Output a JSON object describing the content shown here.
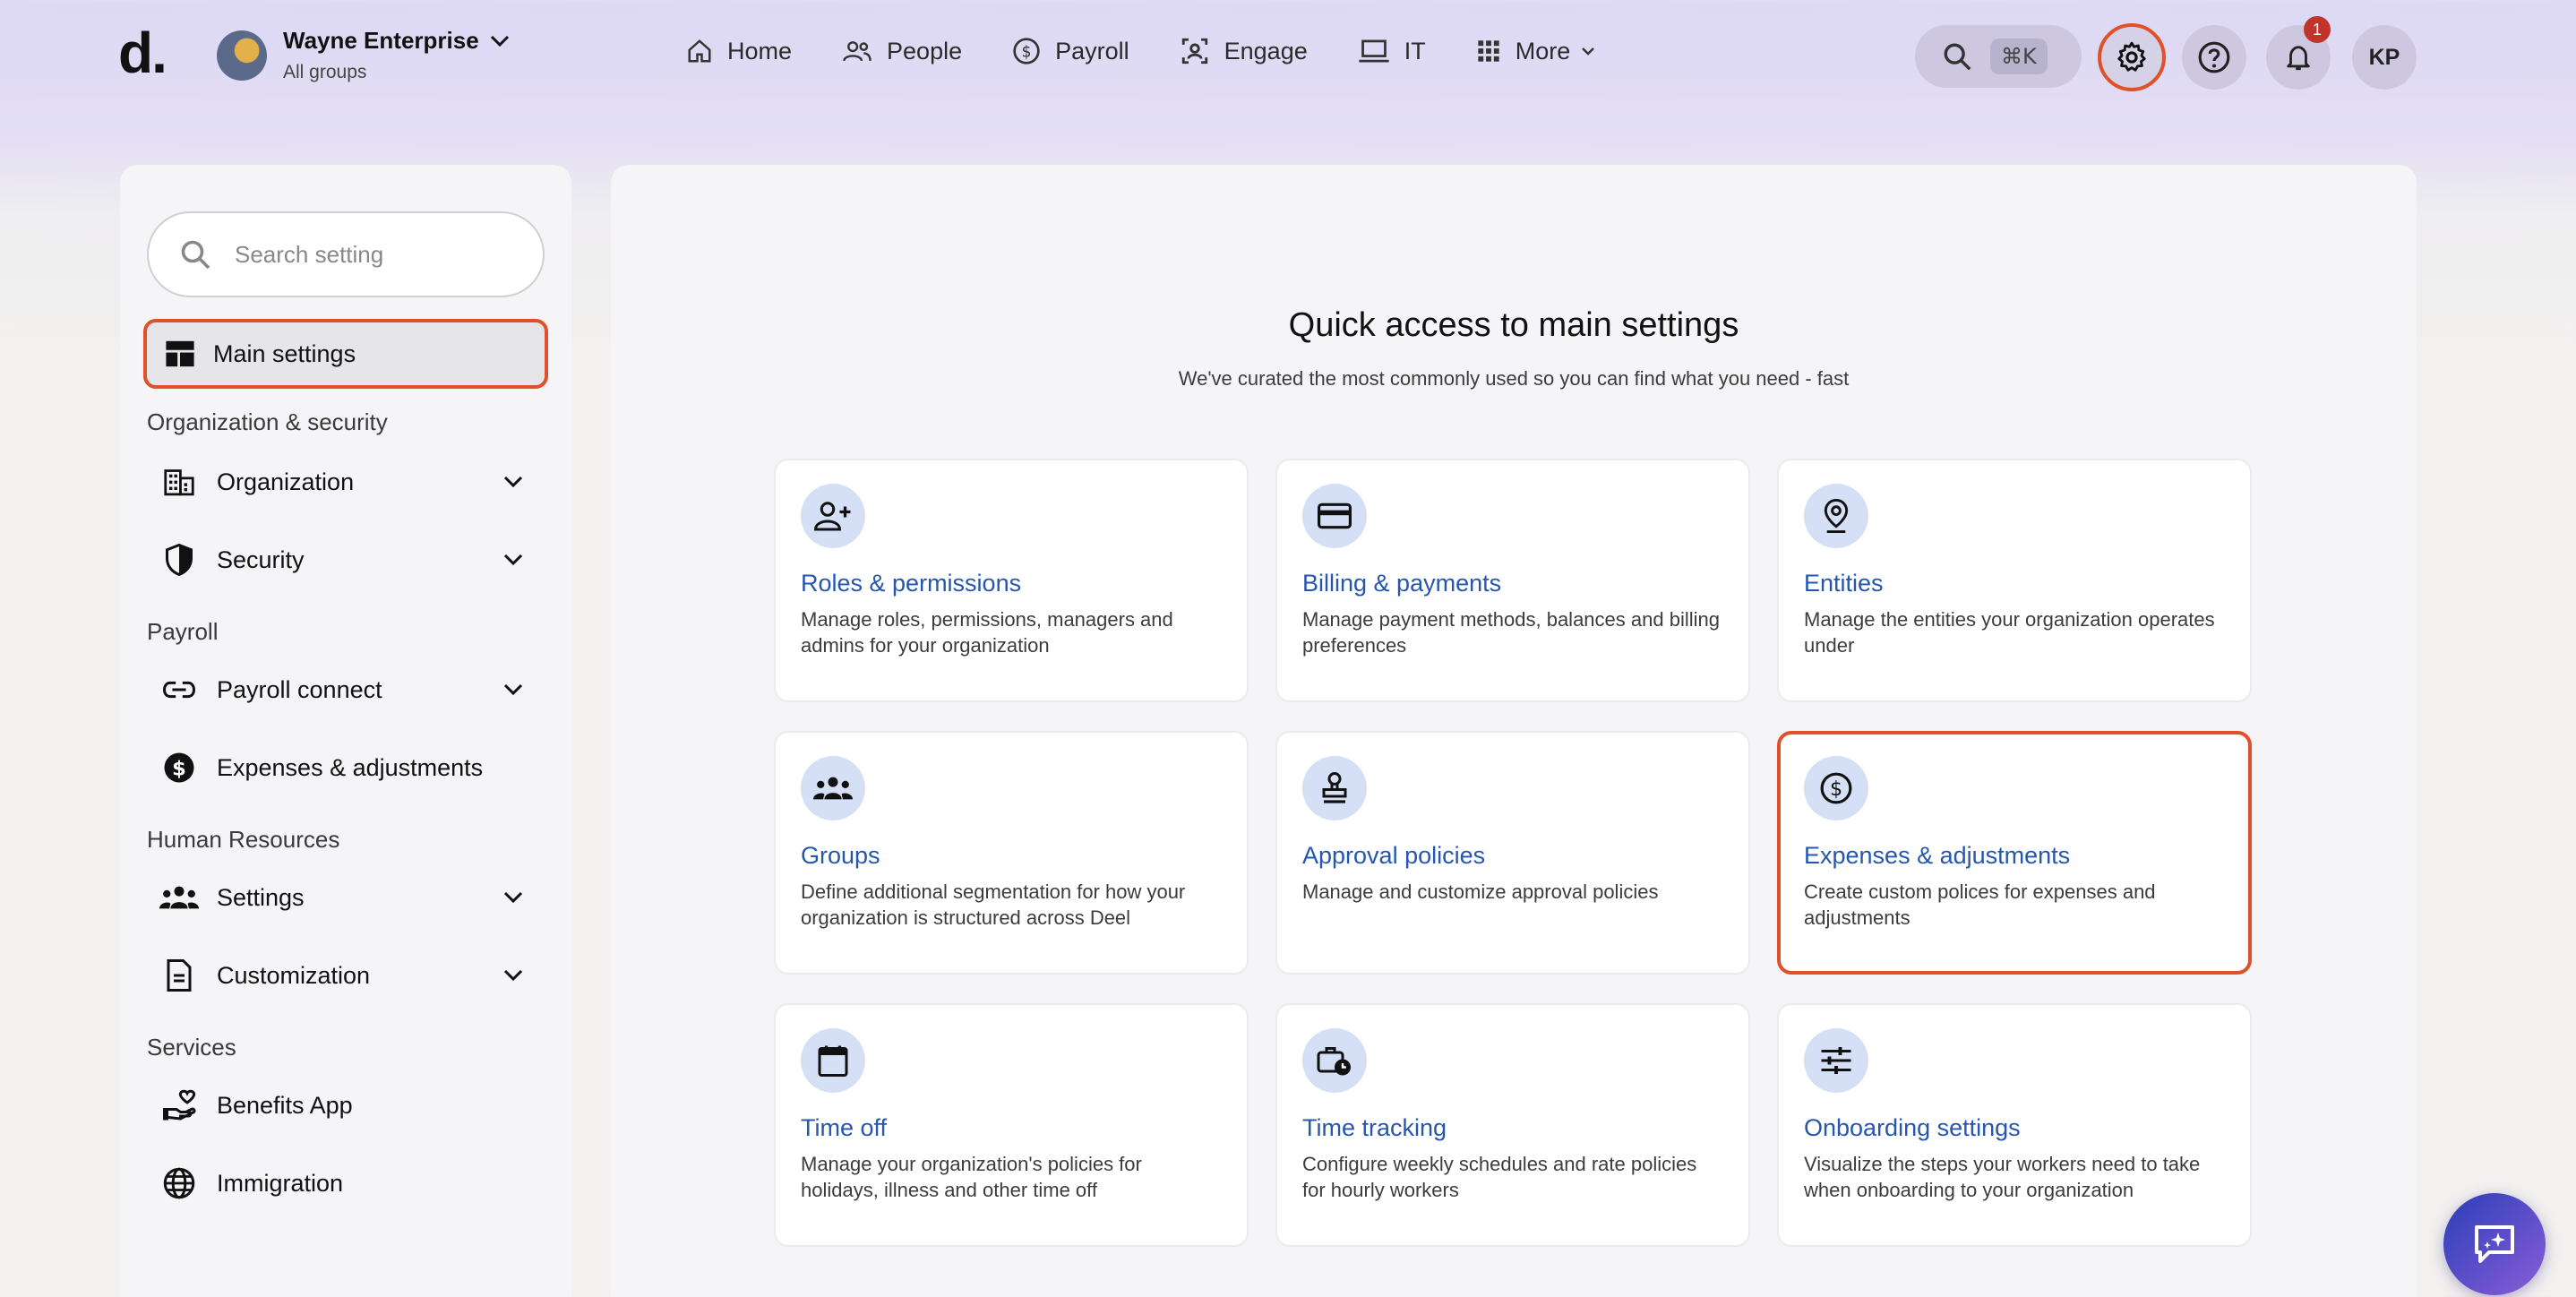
{
  "header": {
    "logo": "d.",
    "org_name": "Wayne Enterprise",
    "org_sub": "All groups",
    "nav": [
      {
        "label": "Home",
        "icon": "home-icon"
      },
      {
        "label": "People",
        "icon": "people-icon"
      },
      {
        "label": "Payroll",
        "icon": "dollar-circle-icon"
      },
      {
        "label": "Engage",
        "icon": "engage-icon"
      },
      {
        "label": "IT",
        "icon": "laptop-icon"
      },
      {
        "label": "More",
        "icon": "grid-icon"
      }
    ],
    "search_shortcut": "⌘K",
    "notification_count": "1",
    "user_initials": "KP"
  },
  "sidebar": {
    "search_placeholder": "Search setting",
    "main_settings": "Main settings",
    "sections": {
      "org_security": "Organization & security",
      "payroll": "Payroll",
      "hr": "Human Resources",
      "services": "Services"
    },
    "items": {
      "organization": "Organization",
      "security": "Security",
      "payroll_connect": "Payroll connect",
      "expenses": "Expenses & adjustments",
      "settings": "Settings",
      "customization": "Customization",
      "benefits": "Benefits App",
      "immigration": "Immigration"
    }
  },
  "main": {
    "title": "Quick access to main settings",
    "subtitle": "We've curated the most commonly used so you can find what you need - fast",
    "cards": [
      {
        "title": "Roles & permissions",
        "desc": "Manage roles, permissions, managers and admins for your organization",
        "icon": "user-plus-icon"
      },
      {
        "title": "Billing & payments",
        "desc": "Manage payment methods, balances and billing preferences",
        "icon": "credit-card-icon"
      },
      {
        "title": "Entities",
        "desc": "Manage the entities your organization operates under",
        "icon": "location-pin-icon"
      },
      {
        "title": "Groups",
        "desc": "Define additional segmentation for how your organization is structured across Deel",
        "icon": "groups-icon"
      },
      {
        "title": "Approval policies",
        "desc": "Manage and customize approval policies",
        "icon": "stamp-icon"
      },
      {
        "title": "Expenses & adjustments",
        "desc": "Create custom polices for expenses and adjustments",
        "icon": "dollar-circle-icon"
      },
      {
        "title": "Time off",
        "desc": "Manage your organization's policies for holidays, illness and other time off",
        "icon": "calendar-icon"
      },
      {
        "title": "Time tracking",
        "desc": "Configure weekly schedules and rate policies for hourly workers",
        "icon": "briefcase-clock-icon"
      },
      {
        "title": "Onboarding settings",
        "desc": "Visualize the steps your workers need to take when onboarding to your organization",
        "icon": "sliders-icon"
      }
    ]
  },
  "colors": {
    "accent_outline": "#e0502a",
    "link_blue": "#2556b0",
    "icon_bg": "#d5e0f6",
    "header_bg": "#ddd8f4"
  }
}
